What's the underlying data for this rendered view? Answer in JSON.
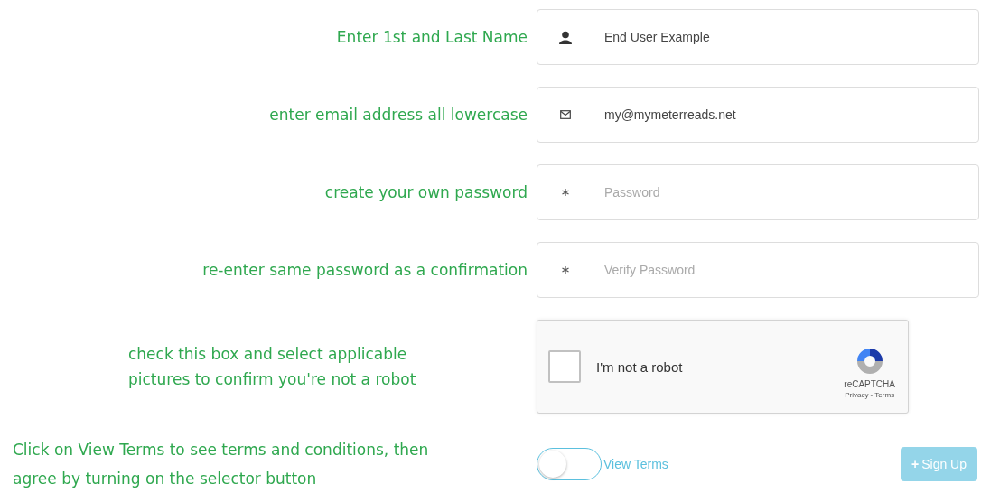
{
  "fields": [
    {
      "hint": "Enter 1st and Last Name",
      "kind": "person",
      "value": "End User Example"
    },
    {
      "hint": "enter email address all lowercase",
      "kind": "email",
      "value": "my@mymeterreads.net"
    },
    {
      "hint": "create your own password",
      "kind": "password",
      "placeholder": "Password"
    },
    {
      "hint": "re-enter same password as a confirmation",
      "kind": "password",
      "placeholder": "Verify Password"
    }
  ],
  "captcha": {
    "hint": "check this box and select applicable pictures to confirm you're not a robot",
    "label": "I'm not a robot",
    "checked": false,
    "brand": "reCAPTCHA",
    "links": "Privacy - Terms"
  },
  "terms": {
    "hint": "Click on View Terms to see terms and conditions, then agree by turning on the selector button",
    "on": false,
    "link": "View Terms"
  },
  "signup": {
    "icon": "+",
    "label": "Sign Up",
    "disabled": true
  }
}
